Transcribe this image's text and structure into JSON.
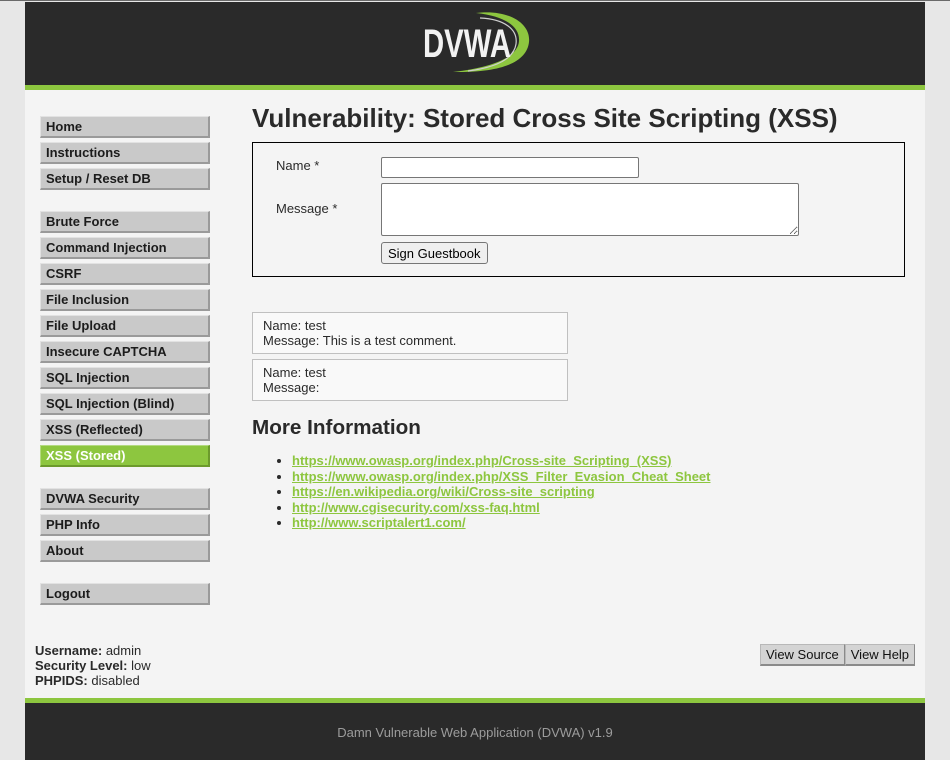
{
  "header": {
    "logo_text": "DVWA"
  },
  "menu": {
    "groups": [
      [
        {
          "label": "Home"
        },
        {
          "label": "Instructions"
        },
        {
          "label": "Setup / Reset DB"
        }
      ],
      [
        {
          "label": "Brute Force"
        },
        {
          "label": "Command Injection"
        },
        {
          "label": "CSRF"
        },
        {
          "label": "File Inclusion"
        },
        {
          "label": "File Upload"
        },
        {
          "label": "Insecure CAPTCHA"
        },
        {
          "label": "SQL Injection"
        },
        {
          "label": "SQL Injection (Blind)"
        },
        {
          "label": "XSS (Reflected)"
        },
        {
          "label": "XSS (Stored)",
          "active": true
        }
      ],
      [
        {
          "label": "DVWA Security"
        },
        {
          "label": "PHP Info"
        },
        {
          "label": "About"
        }
      ],
      [
        {
          "label": "Logout"
        }
      ]
    ]
  },
  "main": {
    "title": "Vulnerability: Stored Cross Site Scripting (XSS)",
    "guestbook_form": {
      "name": {
        "label": "Name *",
        "value": ""
      },
      "message": {
        "label": "Message *",
        "value": ""
      },
      "submit_label": "Sign Guestbook"
    },
    "comment_labels": {
      "name": "Name:",
      "message": "Message:"
    },
    "comments": [
      {
        "name": "test",
        "message": "This is a test comment."
      },
      {
        "name": "test",
        "message": ""
      }
    ],
    "more_info": {
      "heading": "More Information",
      "links": [
        "https://www.owasp.org/index.php/Cross-site_Scripting_(XSS)",
        "https://www.owasp.org/index.php/XSS_Filter_Evasion_Cheat_Sheet",
        "https://en.wikipedia.org/wiki/Cross-site_scripting",
        "http://www.cgisecurity.com/xss-faq.html",
        "http://www.scriptalert1.com/"
      ]
    }
  },
  "session": {
    "username": {
      "label": "Username:",
      "value": "admin"
    },
    "security_level": {
      "label": "Security Level:",
      "value": "low"
    },
    "phpids": {
      "label": "PHPIDS:",
      "value": "disabled"
    }
  },
  "page_buttons": {
    "view_source": "View Source",
    "view_help": "View Help"
  },
  "footer": {
    "text": "Damn Vulnerable Web Application (DVWA) v1.9"
  },
  "colors": {
    "accent": "#8dc63f",
    "header_bg": "#2a2a2a",
    "page_bg": "#f4f4f4",
    "active_text": "#ffffff"
  }
}
